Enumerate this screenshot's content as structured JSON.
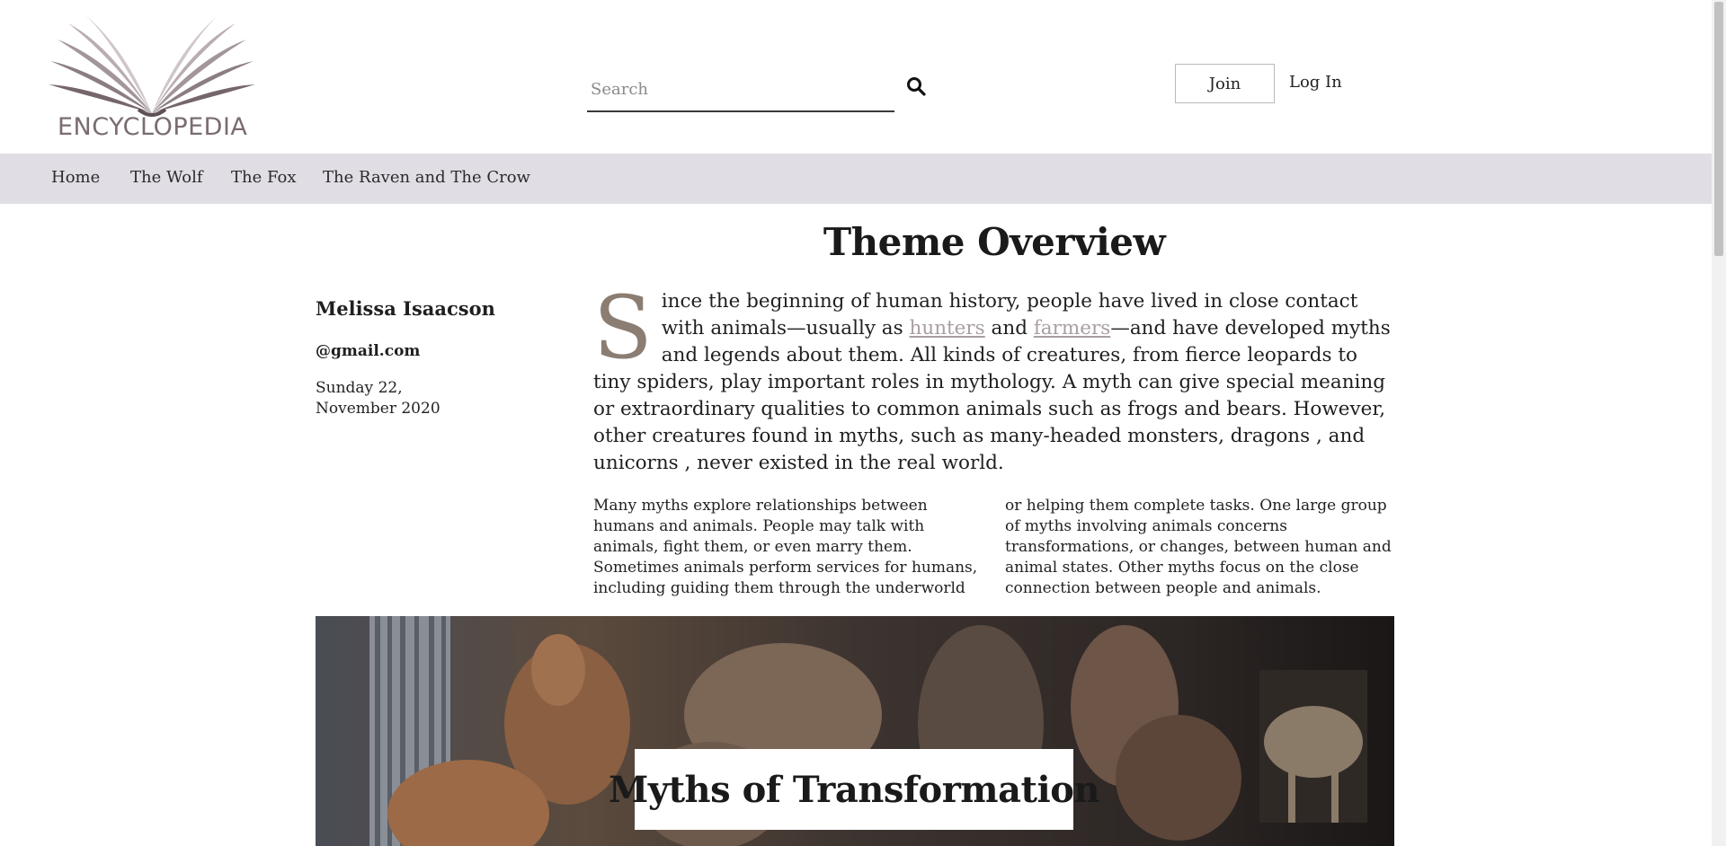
{
  "logo": {
    "text": "ENCYCLOPEDIA",
    "icon": "open-book-icon",
    "colors": [
      "#5e5055",
      "#8c7d82",
      "#b3a7ab",
      "#cfc6c9"
    ]
  },
  "search": {
    "placeholder": "Search",
    "icon": "search-icon"
  },
  "auth": {
    "join_label": "Join",
    "login_label": "Log In"
  },
  "nav": {
    "items": [
      "Home",
      "The Wolf",
      "The Fox",
      "The Raven and The Crow"
    ],
    "background": "#e1dde5"
  },
  "article": {
    "title": "Theme Overview",
    "author": "Melissa Isaacson",
    "email": "@gmail.com",
    "date": "Sunday 22, November 2020",
    "intro": {
      "dropcap": "S",
      "part1": "ince the beginning of human history, people have lived in close contact with animals—usually as ",
      "link1": "hunters",
      "part2": " and ",
      "link2": "farmers",
      "part3": "—and have developed myths and legends about them. All kinds of creatures, from fierce leopards to tiny spiders, play important roles in mythology. A myth can give special meaning or extraordinary qualities to common animals such as frogs and bears. However, other creatures found in myths, such as many-headed monsters, dragons , and unicorns , never existed in the real world."
    },
    "body": "Many myths explore relationships between humans and animals. People may talk with animals, fight them, or even marry them. Sometimes animals perform services for humans, including guiding them through the underworld or helping them complete tasks. One large group of myths involving animals concerns transformations, or changes, between human and animal states. Other myths focus on the close connection between people and animals.",
    "hero_title": "Myths of Transformation"
  },
  "colors": {
    "link": "#a99ea1",
    "dropcap": "#8b7d72",
    "text": "#1f1f1f"
  }
}
